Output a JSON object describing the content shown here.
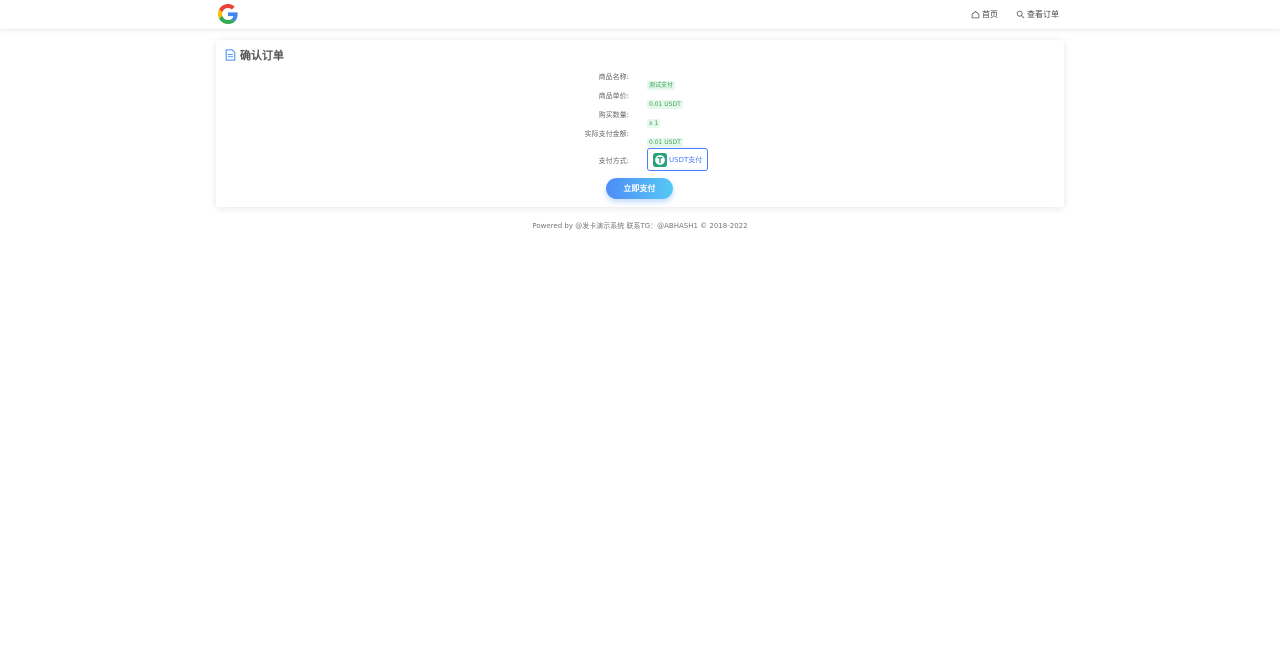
{
  "header": {
    "nav": [
      {
        "label": "首页",
        "icon": "home-icon"
      },
      {
        "label": "查看订单",
        "icon": "search-icon"
      }
    ]
  },
  "order": {
    "title": "确认订单",
    "rows": [
      {
        "label": "商品名称:",
        "value": "测试支付"
      },
      {
        "label": "商品单价:",
        "value": "0.01 USDT"
      },
      {
        "label": "购买数量:",
        "value": "x 1"
      },
      {
        "label": "实际支付金额:",
        "value": "0.01 USDT"
      }
    ],
    "payment_label": "支付方式:",
    "payment_method": "USDT支付",
    "submit_label": "立即支付"
  },
  "footer": {
    "text": "Powered by @发卡演示系统 联系TG：@ABHASH1 © 2018-2022"
  },
  "colors": {
    "accent": "#4a7cff",
    "tag_bg": "#e6f7ec",
    "tag_text": "#3aa65a",
    "usdt_green": "#26a17b"
  }
}
